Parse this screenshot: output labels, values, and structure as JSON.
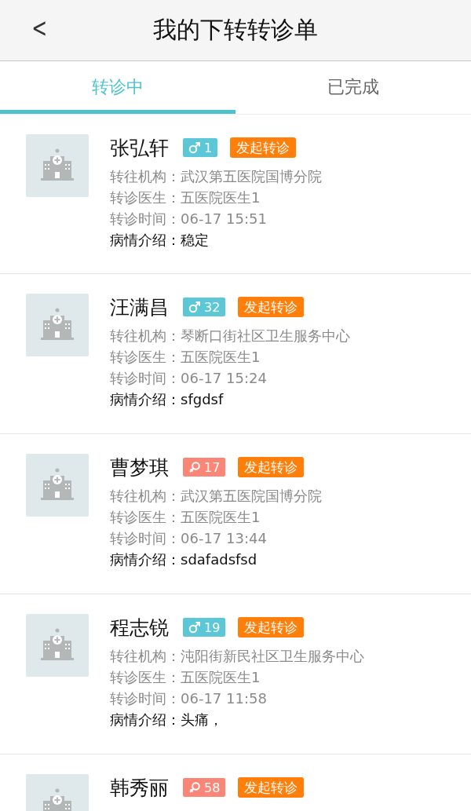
{
  "header": {
    "back": "<",
    "title": "我的下转转诊单"
  },
  "tabs": [
    {
      "label": "转诊中",
      "selected": true
    },
    {
      "label": "已完成",
      "selected": false
    }
  ],
  "records": [
    {
      "name": "张弘轩",
      "kind": "male",
      "age": "1",
      "action": "发起转诊",
      "fields": [
        {
          "kind": "info",
          "label": "转往机构：",
          "value": "武汉第五医院国博分院"
        },
        {
          "kind": "info",
          "label": "转诊医生：",
          "value": "五医院医生1"
        },
        {
          "kind": "info",
          "label": "转诊时间：",
          "value": "06-17 15:51"
        },
        {
          "kind": "condition",
          "label": "病情介绍：",
          "value": "稳定"
        }
      ]
    },
    {
      "name": "汪满昌",
      "kind": "male",
      "age": "32",
      "action": "发起转诊",
      "fields": [
        {
          "kind": "info",
          "label": "转往机构：",
          "value": "琴断口街社区卫生服务中心"
        },
        {
          "kind": "info",
          "label": "转诊医生：",
          "value": "五医院医生1"
        },
        {
          "kind": "info",
          "label": "转诊时间：",
          "value": "06-17 15:24"
        },
        {
          "kind": "condition",
          "label": "病情介绍：",
          "value": "sfgdsf"
        }
      ]
    },
    {
      "name": "曹梦琪",
      "kind": "female",
      "age": "17",
      "action": "发起转诊",
      "fields": [
        {
          "kind": "info",
          "label": "转往机构：",
          "value": "武汉第五医院国博分院"
        },
        {
          "kind": "info",
          "label": "转诊医生：",
          "value": "五医院医生1"
        },
        {
          "kind": "info",
          "label": "转诊时间：",
          "value": "06-17 13:44"
        },
        {
          "kind": "condition",
          "label": "病情介绍：",
          "value": "sdafadsfsd"
        }
      ]
    },
    {
      "name": "程志锐",
      "kind": "male",
      "age": "19",
      "action": "发起转诊",
      "fields": [
        {
          "kind": "info",
          "label": "转往机构：",
          "value": "沌阳街新民社区卫生服务中心"
        },
        {
          "kind": "info",
          "label": "转诊医生：",
          "value": "五医院医生1"
        },
        {
          "kind": "info",
          "label": "转诊时间：",
          "value": "06-17 11:58"
        },
        {
          "kind": "condition",
          "label": "病情介绍：",
          "value": "头痛，"
        }
      ]
    },
    {
      "name": "韩秀丽",
      "kind": "female",
      "age": "58",
      "action": "发起转诊"
    }
  ]
}
